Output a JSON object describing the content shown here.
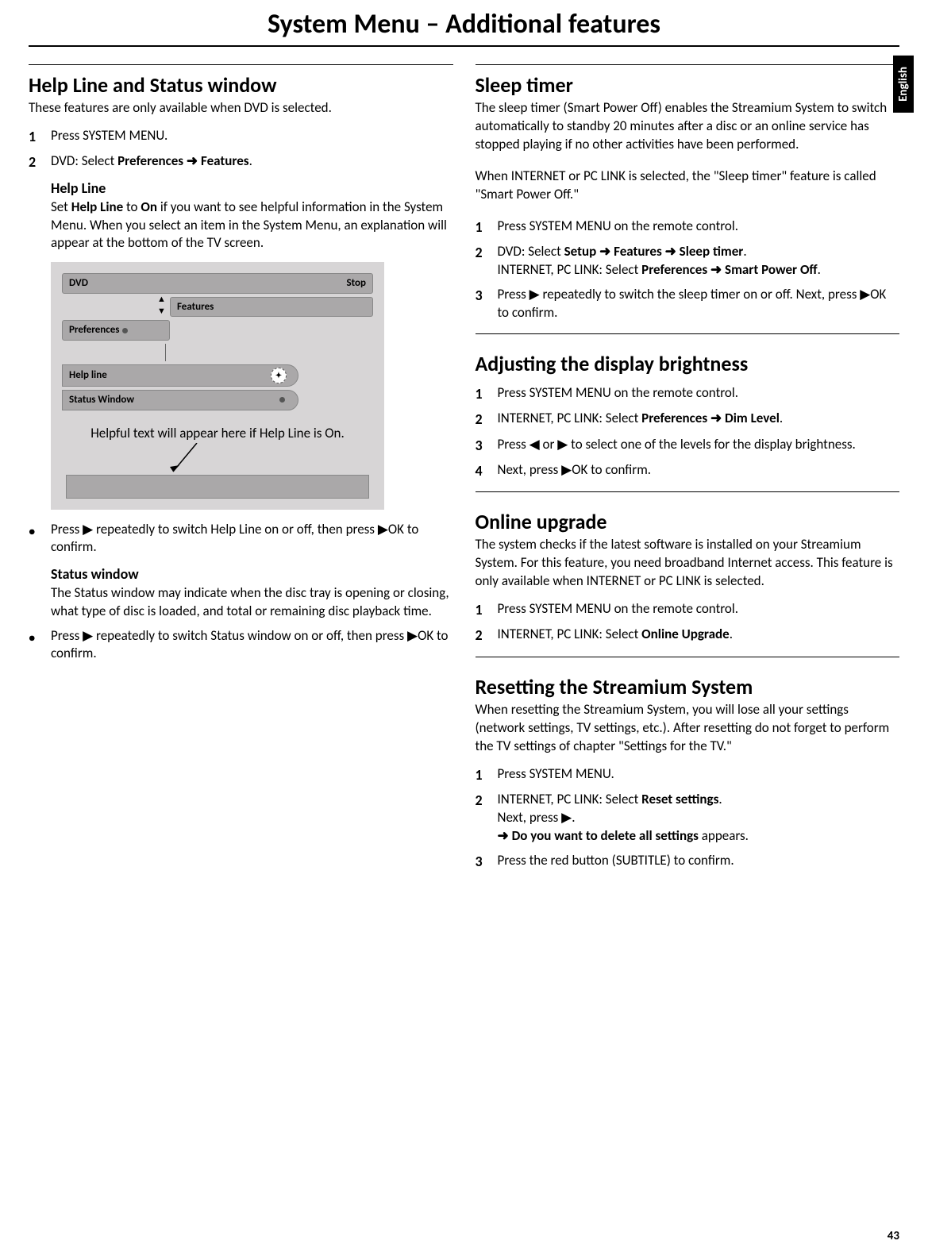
{
  "page_title": "System Menu – Additional features",
  "lang_tab": "English",
  "page_number": "43",
  "left": {
    "h1": "Help Line and Status window",
    "intro": "These features are only available when DVD is selected.",
    "s1": "Press SYSTEM MENU.",
    "s2a": "DVD: Select ",
    "s2b": "Preferences ➜ Features",
    "s2c": ".",
    "sub1": "Help Line",
    "hl1a": "Set ",
    "hl1b": "Help Line",
    "hl1c": " to ",
    "hl1d": "On",
    "hl1e": " if you want to see helpful information in the System Menu. When you select an item in the System Menu, an explanation will appear at the bottom of the TV screen.",
    "diagram": {
      "dvd": "DVD",
      "stop": "Stop",
      "features": "Features",
      "prefs": "Preferences",
      "helpline": "Help line",
      "status": "Status Window",
      "msg": "Helpful text will appear here if Help Line is On."
    },
    "b1a": "Press ",
    "b1b": " repeatedly to switch Help Line on or off, then press ",
    "b1c": "OK to confirm.",
    "sub2": "Status window",
    "sw": "The Status window may indicate when the disc tray is opening or closing, what type of disc is loaded, and total or remaining disc playback time.",
    "b2a": "Press ",
    "b2b": " repeatedly to switch Status window on or off, then press ",
    "b2c": "OK to confirm."
  },
  "sleep": {
    "h": "Sleep timer",
    "p1": "The sleep timer (Smart Power Off) enables the Streamium System to switch automatically to standby 20 minutes after a disc or an online service has stopped playing if no other activities have been performed.",
    "p2": "When INTERNET or PC LINK is selected, the \"Sleep timer\" feature is called \"Smart Power Off.\"",
    "s1": "Press SYSTEM MENU on the remote control.",
    "s2a": "DVD: Select ",
    "s2b": "Setup ➜ Features ➜ Sleep timer",
    "s2c": ".",
    "s2d": "INTERNET, PC LINK: Select ",
    "s2e": "Preferences ➜ Smart Power Off",
    "s2f": ".",
    "s3a": "Press ",
    "s3b": " repeatedly to switch the sleep timer on or off. Next, press ",
    "s3c": "OK to confirm."
  },
  "bright": {
    "h": "Adjusting the display brightness",
    "s1": "Press SYSTEM MENU on the remote control.",
    "s2a": "INTERNET, PC LINK: Select ",
    "s2b": "Preferences ➜ Dim Level",
    "s2c": ".",
    "s3a": "Press ",
    "s3b": " or ",
    "s3c": " to select one of the levels for the display brightness.",
    "s4a": "Next, press ",
    "s4b": "OK to confirm."
  },
  "upg": {
    "h": "Online upgrade",
    "p": "The system checks if the latest software is installed on your Streamium System. For this feature, you need broadband Internet access. This feature is only available when INTERNET or PC LINK is selected.",
    "s1": "Press SYSTEM MENU on the remote control.",
    "s2a": "INTERNET, PC LINK: Select ",
    "s2b": "Online Upgrade",
    "s2c": "."
  },
  "reset": {
    "h": "Resetting the Streamium System",
    "p": "When resetting the Streamium System, you will lose all your settings (network settings, TV settings, etc.). After resetting do not forget to perform the TV settings of chapter \"Settings for the TV.\"",
    "s1": "Press SYSTEM MENU.",
    "s2a": "INTERNET, PC LINK: Select ",
    "s2b": "Reset settings",
    "s2c": ".",
    "s2d": "Next, press ",
    "s2e": ".",
    "s2f": "➜ Do you want to delete all settings",
    "s2g": " appears.",
    "s3": "Press the red button (SUBTITLE) to confirm."
  }
}
